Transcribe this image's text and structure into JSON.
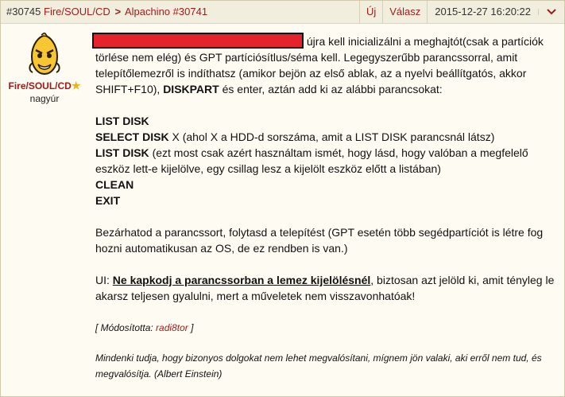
{
  "header": {
    "post_id": "#30745",
    "author": "Fire/SOUL/CD",
    "reply_to_name": "Alpachino",
    "reply_to_id": "#30741",
    "new_label": "Új",
    "reply_label": "Válasz",
    "date": "2015-12-27 16:20:22",
    "icons": {
      "chevron": "chevron-right-icon",
      "menu": "chevron-down-icon"
    }
  },
  "colors": {
    "accent": "#a01c1c",
    "header_bg": "#f1eedd",
    "post_bg": "#fefcf2",
    "redaction": "#e5232d"
  },
  "user": {
    "name": "Fire/SOUL/CD",
    "rank": "nagyúr",
    "avatar_icon": "lemon-mascot-icon",
    "badge_icon": "star-icon"
  },
  "post": {
    "p1": "újra kell inicializálni a meghajtót(csak a partíciók törlése nem elég) és GPT partíciósítlus/séma kell. Legegyszerűbb parancssorral, amit telepítőlemezről is indíthatsz (amikor bejön az első ablak, az a nyelvi beállítgatós, akkor SHIFT+F10),",
    "p1_cmd": "DISKPART",
    "p1_tail": "és enter, aztán add ki az alábbi parancsokat:",
    "cmd1": "LIST DISK",
    "cmd2": "SELECT DISK",
    "cmd2_text": "X (ahol X a HDD-d sorszáma, amit a LIST DISK parancsnál látsz)",
    "cmd3": "LIST DISK",
    "cmd3_text": "(ezt most csak azért használtam ismét, hogy lásd, hogy valóban a megfelelő eszköz lett-e kijelölve, egy csillag lesz a kijelölt eszköz előtt a listában)",
    "cmd4": "CLEAN",
    "cmd5": "EXIT",
    "p2": "Bezárhatod a parancssort, folytasd a telepítést (GPT esetén több segédpartíciót is létre fog hozni automatikusan az OS, de ez rendben is van.)",
    "ui_prefix": "UI:",
    "ui_bold": "Ne kapkodj a parancssorban a lemez kijelölésnél",
    "ui_rest": ", biztosan azt jelöld ki, amit tényleg le akarsz teljesen gyalulni, mert a műveletek nem visszavonhatóak!",
    "modified_prefix": "[ Módosította:",
    "modified_user": "radi8tor",
    "modified_suffix": "]",
    "signature": "Mindenki tudja, hogy bizonyos dolgokat nem lehet megvalósítani, mígnem jön valaki, aki erről nem tud, és megvalósítja. (Albert Einstein)"
  }
}
